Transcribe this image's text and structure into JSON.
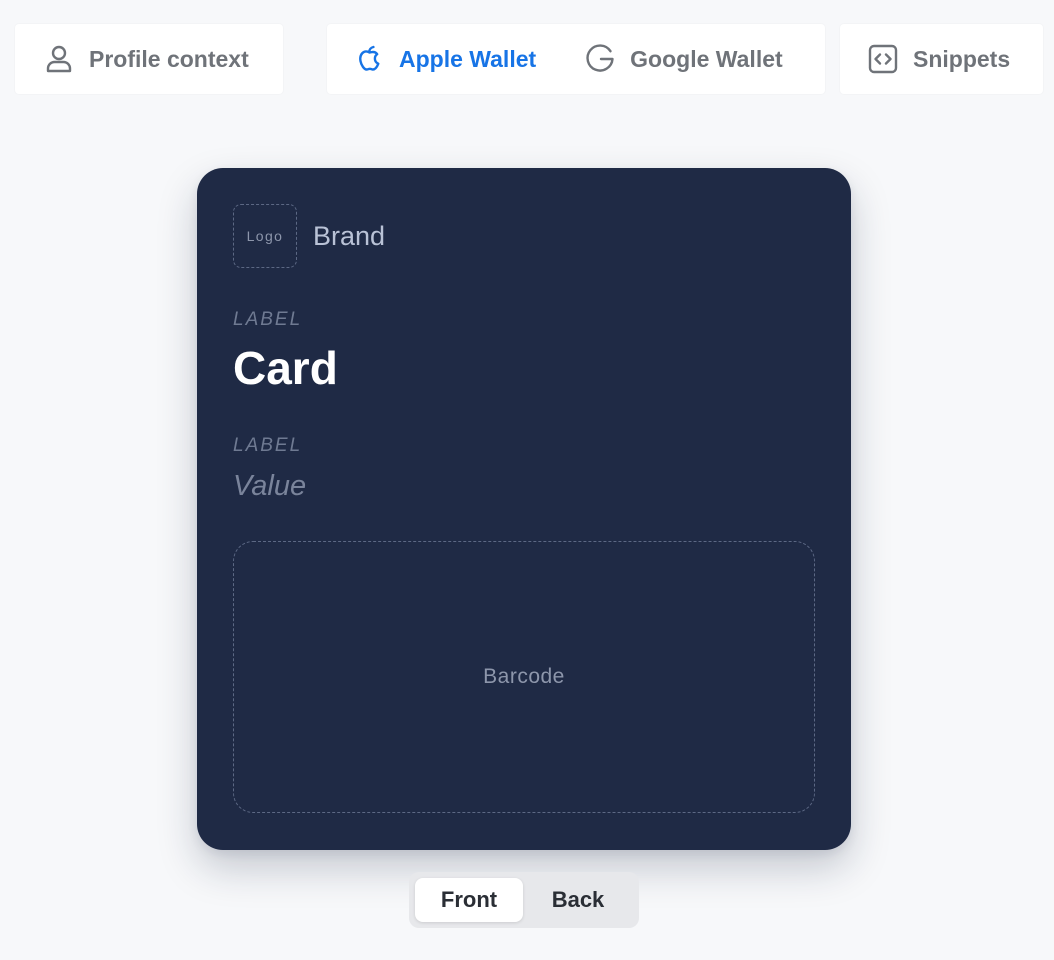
{
  "tabs": {
    "profile": {
      "label": "Profile context",
      "icon": "user-icon"
    },
    "apple": {
      "label": "Apple Wallet",
      "icon": "apple-icon",
      "active": true
    },
    "google": {
      "label": "Google Wallet",
      "icon": "google-icon"
    },
    "snippets": {
      "label": "Snippets",
      "icon": "code-icon"
    }
  },
  "card": {
    "logo_placeholder": "Logo",
    "brand": "Brand",
    "field1_label": "LABEL",
    "primary_value": "Card",
    "field2_label": "LABEL",
    "secondary_value": "Value",
    "barcode_placeholder": "Barcode",
    "background_color": "#1f2a45"
  },
  "toggle": {
    "front": "Front",
    "back": "Back",
    "selected": "Front"
  },
  "colors": {
    "accent": "#1774e6",
    "tab_text": "#6f7379",
    "page_background": "#f7f8fa"
  }
}
